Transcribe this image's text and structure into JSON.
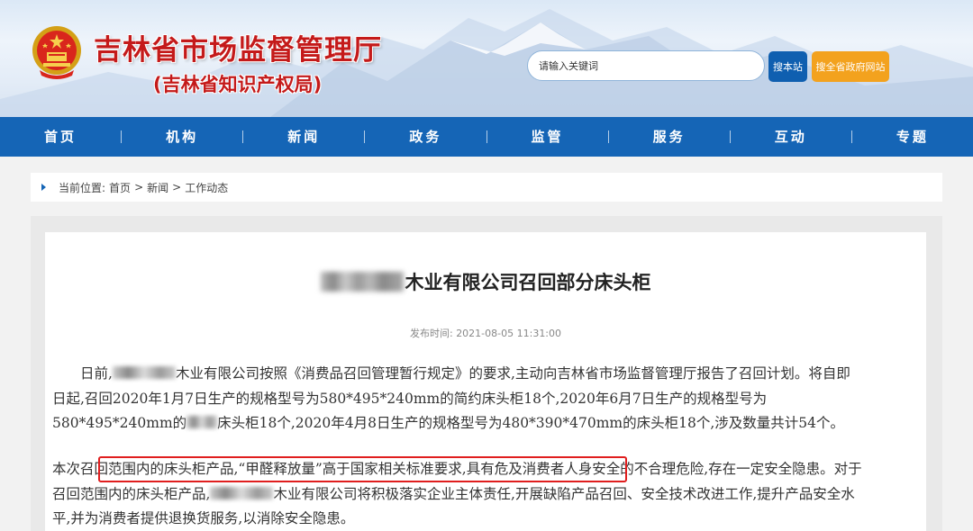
{
  "header": {
    "site_title": "吉林省市场监督管理厅",
    "site_subtitle": "(吉林省知识产权局)",
    "search_placeholder": "请输入关键词",
    "search_button": "搜本站",
    "province_button": "搜全省政府网站"
  },
  "nav": {
    "items": [
      "首页",
      "机构",
      "新闻",
      "政务",
      "监管",
      "服务",
      "互动",
      "专题"
    ]
  },
  "breadcrumb": {
    "prefix": "当前位置:",
    "items": [
      "首页",
      "新闻",
      "工作动态"
    ],
    "separator": ">"
  },
  "article": {
    "title": "木业有限公司召回部分床头柜",
    "meta_label": "发布时间:",
    "meta_time": "2021-08-05 11:31:00",
    "p1_a": "日前,",
    "p1_b": "木业有限公司按照《消费品召回管理暂行规定》的要求,主动向吉林省市场监督管理厅报告了召回计划。将自即日起,召回2020年1月7日生产的规格型号为580*495*240mm的简约床头柜18个,2020年6月7日生产的规格型号为580*495*240mm的",
    "p1_c": "床头柜18个,2020年4月8日生产的规格型号为480*390*470mm的床头柜18个,涉及数量共计54个。",
    "p2_a": "本次召回范围内的床头柜产品,“甲醛释放量”高于国家相关标准要求,具有危及消费者人身安全的不合理危险,存在一定安全隐患。对于召回范围内的床头柜产品,",
    "p2_b": "木业有限公司将积极落实企业主体责任,开展缺陷产品召回、安全技术改进工作,提升产品安全水平,并为消费者提供退换货服务,以消除安全隐患。"
  },
  "colors": {
    "nav_bg": "#1565b6",
    "title_red": "#c41a1a",
    "search_btn": "#0f5fb0",
    "province_btn": "#f3a21e",
    "highlight": "#e01e1e"
  }
}
